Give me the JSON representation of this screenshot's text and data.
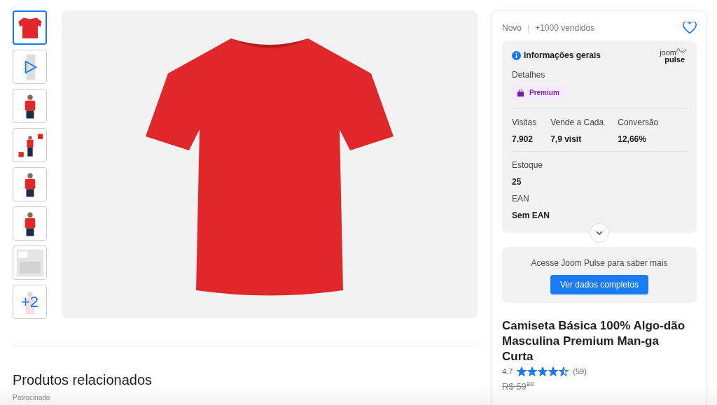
{
  "gallery": {
    "thumbnails": [
      {
        "kind": "shirt",
        "selected": true
      },
      {
        "kind": "video",
        "selected": false
      },
      {
        "kind": "model",
        "selected": false
      },
      {
        "kind": "collage",
        "selected": false
      },
      {
        "kind": "model",
        "selected": false
      },
      {
        "kind": "model",
        "selected": false
      },
      {
        "kind": "chart",
        "selected": false
      },
      {
        "kind": "more",
        "selected": false,
        "label": "+2"
      }
    ]
  },
  "related": {
    "title": "Produtos relacionados",
    "subtitle": "Patrocinado"
  },
  "panel": {
    "condition": "Novo",
    "separator": "|",
    "sold": "+1000 vendidos",
    "favorite": false,
    "info": {
      "title": "Informações gerais",
      "logo_top": "joom",
      "logo_bottom": "pulse",
      "details_label": "Detalhes",
      "badge": "Premium",
      "stats": [
        {
          "label": "Visitas",
          "value": "7.902"
        },
        {
          "label": "Vende a Cada",
          "value": "7,9 visit"
        },
        {
          "label": "Conversão",
          "value": "12,66%"
        }
      ],
      "fields": [
        {
          "label": "Estoque",
          "value": "25"
        },
        {
          "label": "EAN",
          "value": "Sem EAN"
        }
      ]
    },
    "promo": {
      "text": "Acesse Joom Pulse para saber mais",
      "button": "Ver dados completos"
    },
    "product": {
      "title": "Camiseta Básica 100% Algo-dão Masculina Premium Man-ga Curta",
      "rating": "4.7",
      "stars": 4.5,
      "reviews": "(59)",
      "old_price": "R$ 59$^{90}$"
    }
  }
}
